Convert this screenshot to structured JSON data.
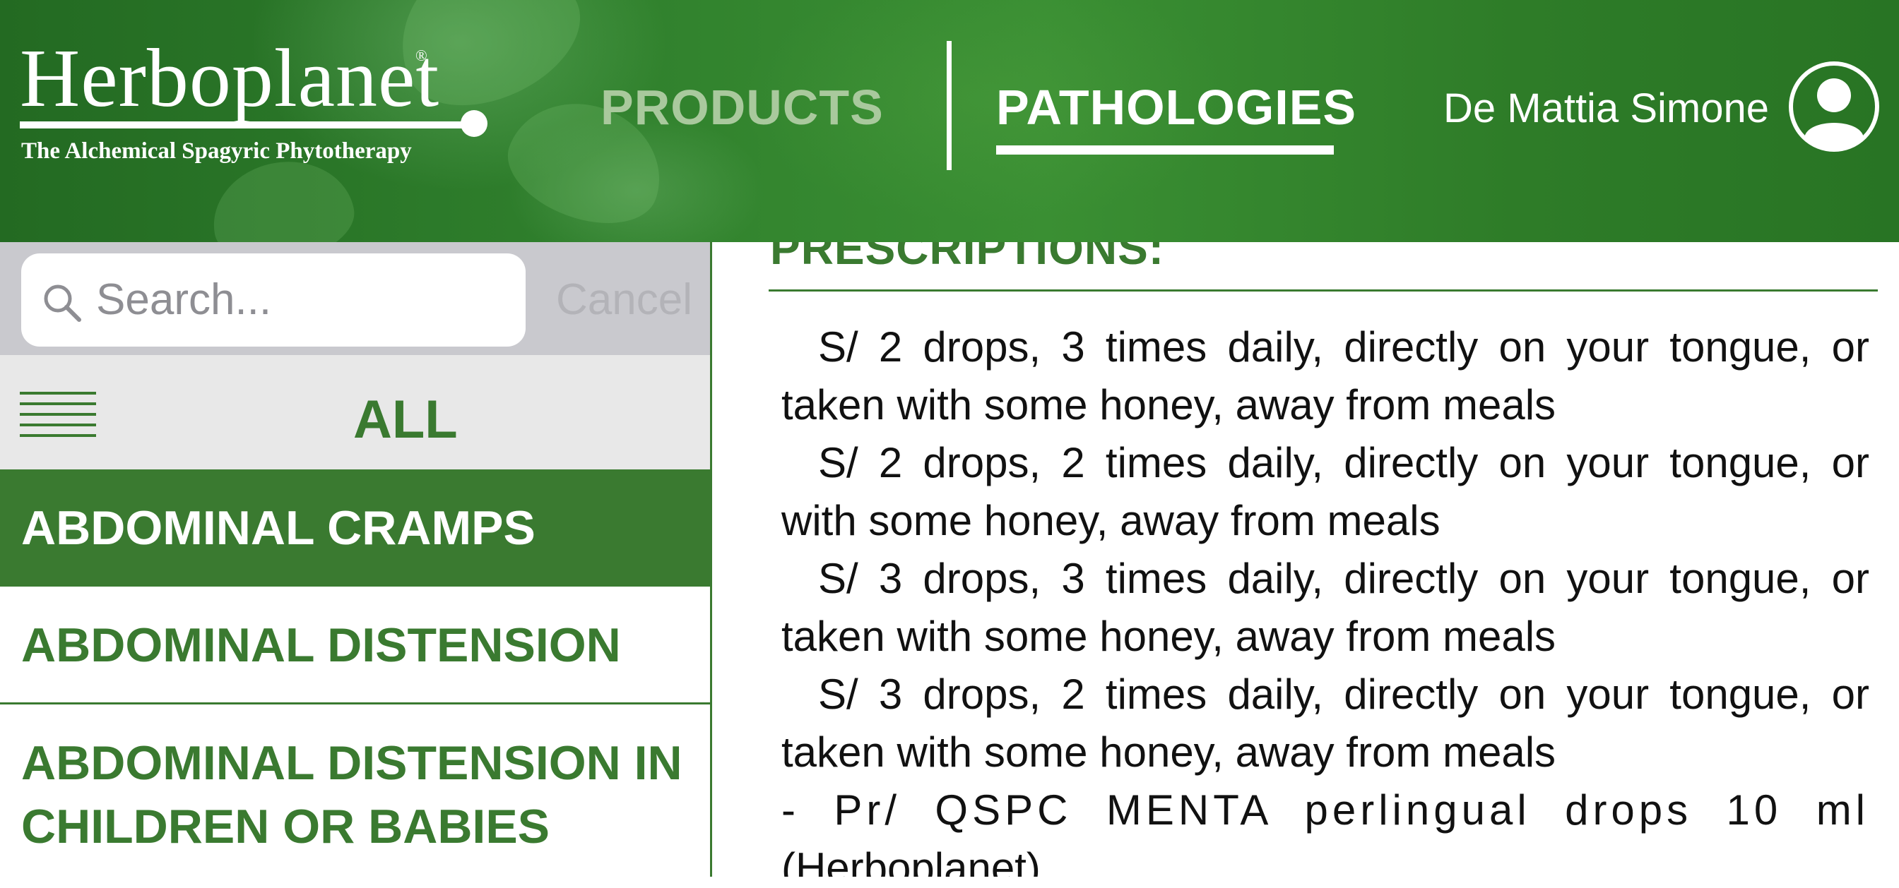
{
  "header": {
    "brand_name": "Herboplanet",
    "brand_reg": "®",
    "brand_tagline": "The Alchemical Spagyric Phytotherapy",
    "nav_products": "PRODUCTS",
    "nav_pathologies": "PATHOLOGIES",
    "active_tab": "PATHOLOGIES",
    "user_name": "De Mattia Simone"
  },
  "sidebar": {
    "search_placeholder": "Search...",
    "cancel_label": "Cancel",
    "filter_label": "ALL",
    "items": [
      {
        "label": "ABDOMINAL CRAMPS",
        "active": true
      },
      {
        "label": "ABDOMINAL DISTENSION",
        "active": false
      },
      {
        "label_line1": "ABDOMINAL DISTENSION IN",
        "label_line2": "CHILDREN OR BABIES",
        "active": false
      }
    ]
  },
  "content": {
    "section_title": "PRESCRIPTIONS:",
    "prescriptions": [
      {
        "line1": "S/ 2 drops, 3 times daily, directly on your tongue, or",
        "line2": "taken with some honey, away from meals"
      },
      {
        "line1": "S/ 2 drops, 2 times daily, directly on your tongue, or",
        "line2": "with some honey, away from meals"
      },
      {
        "line1": "S/ 3 drops, 3 times daily, directly on your tongue, or",
        "line2": "taken with some honey, away from meals"
      },
      {
        "line1": "S/ 3 drops, 2 times daily, directly on your tongue, or",
        "line2": "taken with some honey, away from meals"
      }
    ],
    "product_line1": "- Pr/ QSPC MENTA perlingual drops 10 ml",
    "product_line2": "(Herboplanet)"
  },
  "colors": {
    "brand_green": "#3a7a30",
    "header_green": "#2f7f2c",
    "inactive_tab": "#a9c99d"
  }
}
